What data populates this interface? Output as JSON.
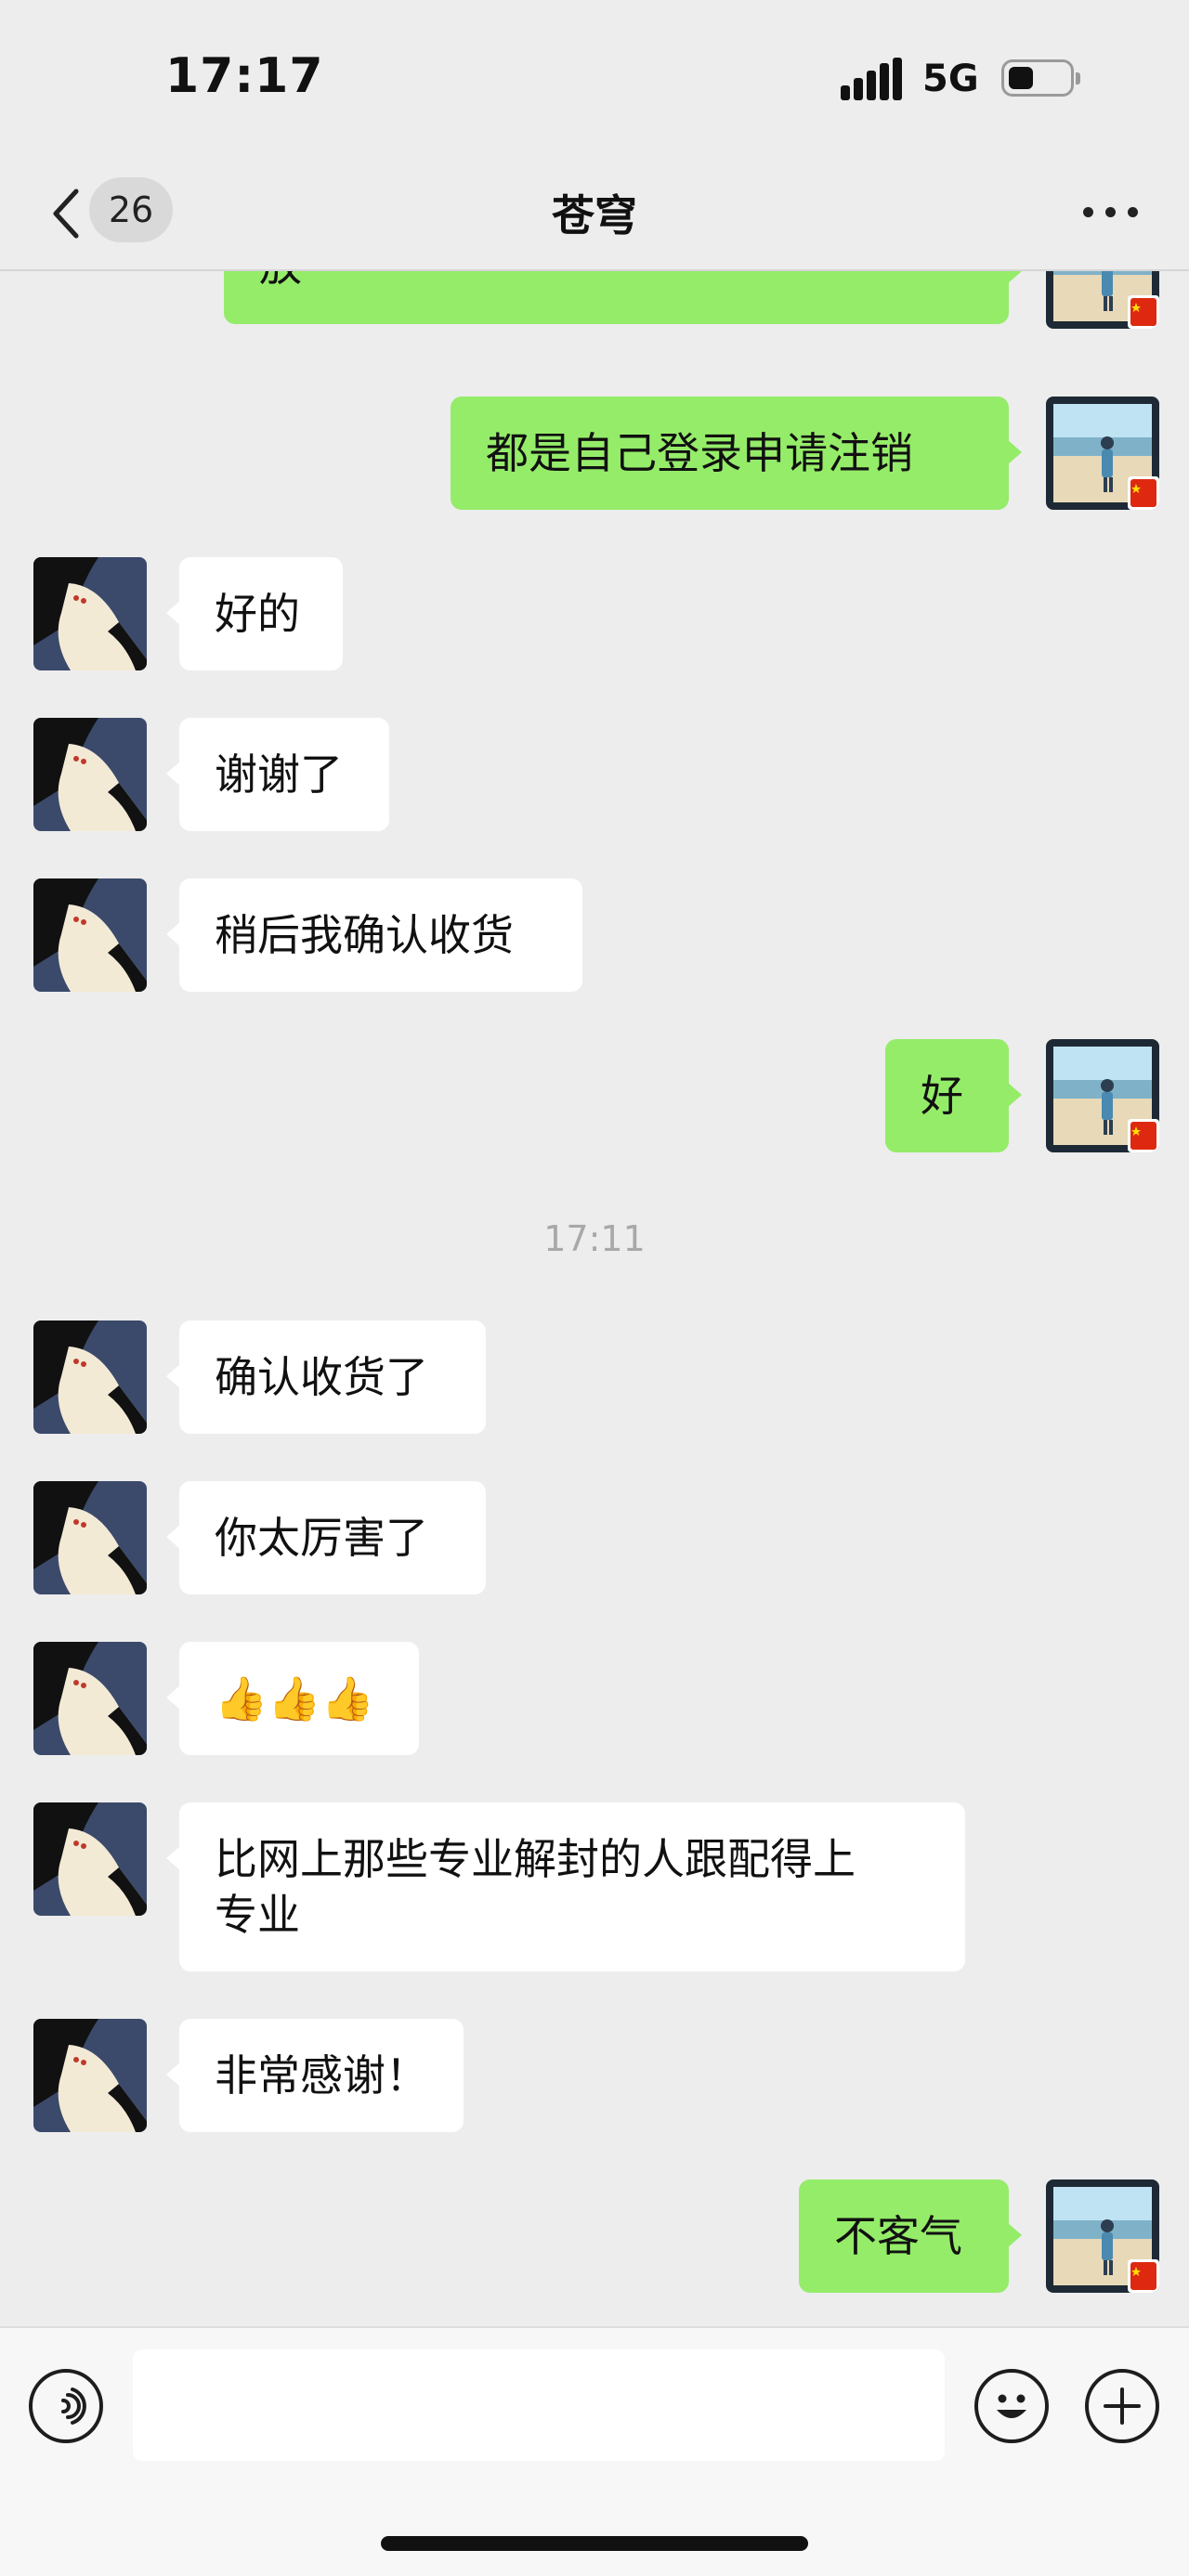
{
  "status_bar": {
    "time": "17:17",
    "network": "5G",
    "battery_level": 0.42
  },
  "nav": {
    "unread_count": "26",
    "title": "苍穹"
  },
  "messages": [
    {
      "side": "right",
      "text": "放",
      "partial": true
    },
    {
      "side": "right",
      "text": "都是自己登录申请注销"
    },
    {
      "side": "left",
      "text": "好的"
    },
    {
      "side": "left",
      "text": "谢谢了"
    },
    {
      "side": "left",
      "text": "稍后我确认收货"
    },
    {
      "side": "right",
      "text": "好"
    },
    {
      "type": "time",
      "text": "17:11"
    },
    {
      "side": "left",
      "text": "确认收货了"
    },
    {
      "side": "left",
      "text": "你太厉害了"
    },
    {
      "side": "left",
      "text": "👍👍👍"
    },
    {
      "side": "left",
      "text": "比网上那些专业解封的人跟配得上\n专业"
    },
    {
      "side": "left",
      "text": "非常感谢！"
    },
    {
      "side": "right",
      "text": "不客气"
    }
  ],
  "input": {
    "value": "",
    "placeholder": ""
  },
  "icons": {
    "back": "chevron-left-icon",
    "more": "more-dots-icon",
    "voice": "voice-icon",
    "emoji": "emoji-icon",
    "add": "plus-icon"
  },
  "colors": {
    "sent_bubble": "#95ec69",
    "received_bubble": "#ffffff",
    "background": "#ededed"
  }
}
